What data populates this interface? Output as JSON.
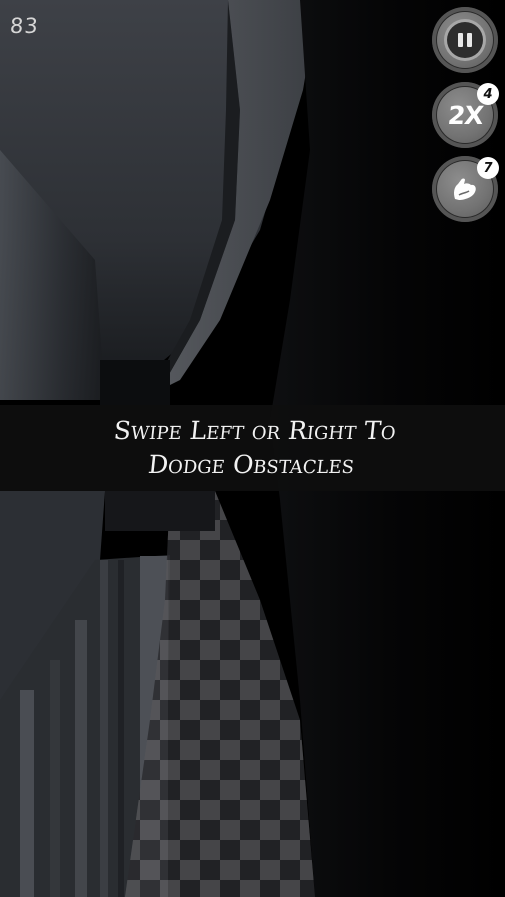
{
  "hud": {
    "score": "83",
    "pause": {
      "icon": "pause-icon"
    },
    "multiplier": {
      "label": "2X",
      "count": "4"
    },
    "boost": {
      "icon": "flexed-arm-icon",
      "count": "7"
    }
  },
  "tutorial": {
    "text": "Swipe Left or Right To Dodge Obstacles"
  }
}
